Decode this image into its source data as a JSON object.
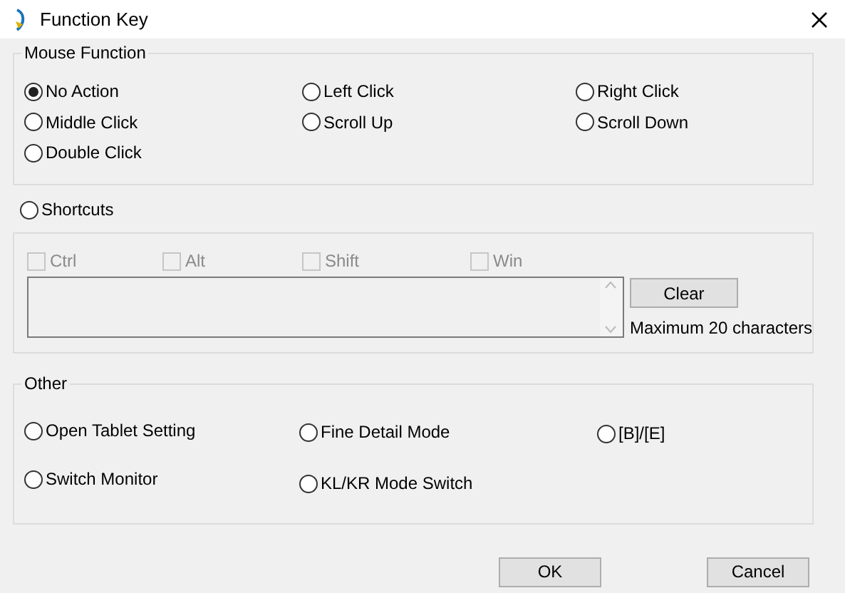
{
  "window": {
    "title": "Function Key"
  },
  "mouse_function": {
    "label": "Mouse Function",
    "options": [
      {
        "label": "No Action",
        "selected": true
      },
      {
        "label": "Left Click",
        "selected": false
      },
      {
        "label": "Right Click",
        "selected": false
      },
      {
        "label": "Middle Click",
        "selected": false
      },
      {
        "label": "Scroll Up",
        "selected": false
      },
      {
        "label": "Scroll Down",
        "selected": false
      },
      {
        "label": "Double Click",
        "selected": false
      }
    ]
  },
  "shortcuts": {
    "label": "Shortcuts",
    "selected": false,
    "modifiers": [
      {
        "label": "Ctrl",
        "checked": false,
        "disabled": true
      },
      {
        "label": "Alt",
        "checked": false,
        "disabled": true
      },
      {
        "label": "Shift",
        "checked": false,
        "disabled": true
      },
      {
        "label": "Win",
        "checked": false,
        "disabled": true
      }
    ],
    "clear_button": "Clear",
    "hint": "Maximum 20 characters"
  },
  "other": {
    "label": "Other",
    "options": [
      {
        "label": "Open Tablet Setting",
        "selected": false
      },
      {
        "label": "Fine Detail Mode",
        "selected": false
      },
      {
        "label": "[B]/[E]",
        "selected": false
      },
      {
        "label": "Switch Monitor",
        "selected": false
      },
      {
        "label": "KL/KR Mode Switch",
        "selected": false
      }
    ]
  },
  "buttons": [
    "OK",
    "Cancel"
  ]
}
